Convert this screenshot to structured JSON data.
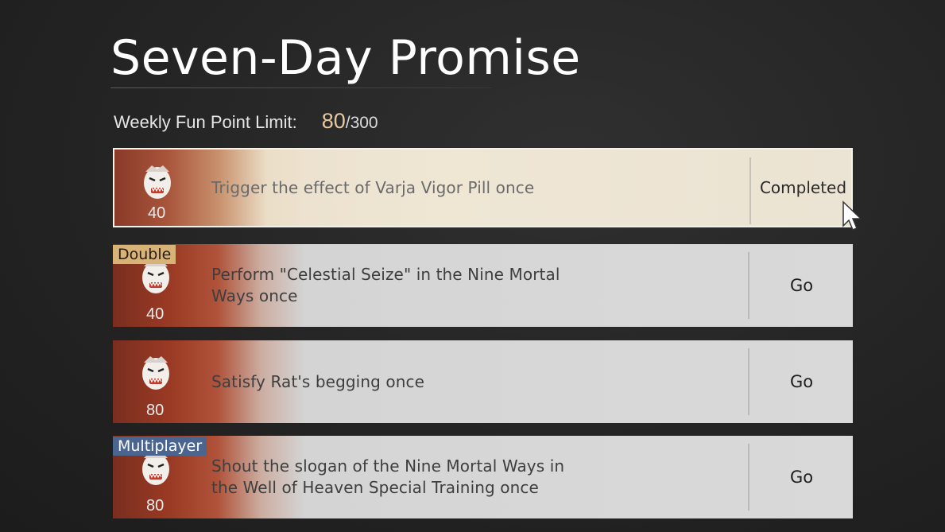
{
  "page": {
    "title": "Seven-Day Promise"
  },
  "limit": {
    "label": "Weekly Fun Point Limit:",
    "current": "80",
    "max": "/300"
  },
  "tasks": [
    {
      "points": "40",
      "text": "Trigger the effect of Varja Vigor Pill once",
      "action": "Completed",
      "tag": "",
      "state": "completed"
    },
    {
      "points": "40",
      "text": "Perform \"Celestial Seize\" in the Nine Mortal Ways once",
      "action": "Go",
      "tag": "Double",
      "state": "available"
    },
    {
      "points": "80",
      "text": "Satisfy Rat's begging once",
      "action": "Go",
      "tag": "",
      "state": "available"
    },
    {
      "points": "80",
      "text": "Shout the slogan of the Nine Mortal Ways in the Well of Heaven Special Training once",
      "action": "Go",
      "tag": "Multiplayer",
      "state": "available"
    }
  ],
  "icons": {
    "reward": "oni-mask-icon",
    "cursor": "mouse-cursor-icon"
  }
}
